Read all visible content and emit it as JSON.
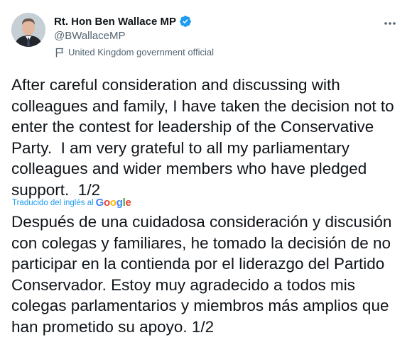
{
  "author": {
    "display_name": "Rt. Hon Ben Wallace MP",
    "handle": "@BWallaceMP",
    "label": "United Kingdom government official"
  },
  "tweet": {
    "text": "After careful consideration and discussing with\ncolleagues and family, I have taken the decision not to\nenter the contest for leadership of the Conservative\nParty.  I am very grateful to all my parliamentary\ncolleagues and wider members who have pledged\nsupport.  1/2",
    "translated_by_label": "Traducido del inglés al",
    "translation_provider": "Google",
    "translation": "Después de una cuidadosa consideración y discusión\ncon colegas y familiares, he tomado la decisión de no\nparticipar en la contienda por el liderazgo del Partido\nConservador. Estoy muy agradecido a todos mis\ncolegas parlamentarios y miembros más amplios que\nhan prometido su apoyo. 1/2"
  },
  "icons": {
    "verified": "verified-badge-icon",
    "label": "flag-icon",
    "more": "more-options-icon"
  },
  "colors": {
    "text_primary": "#0f1419",
    "text_secondary": "#536471",
    "accent": "#1d9bf0"
  }
}
